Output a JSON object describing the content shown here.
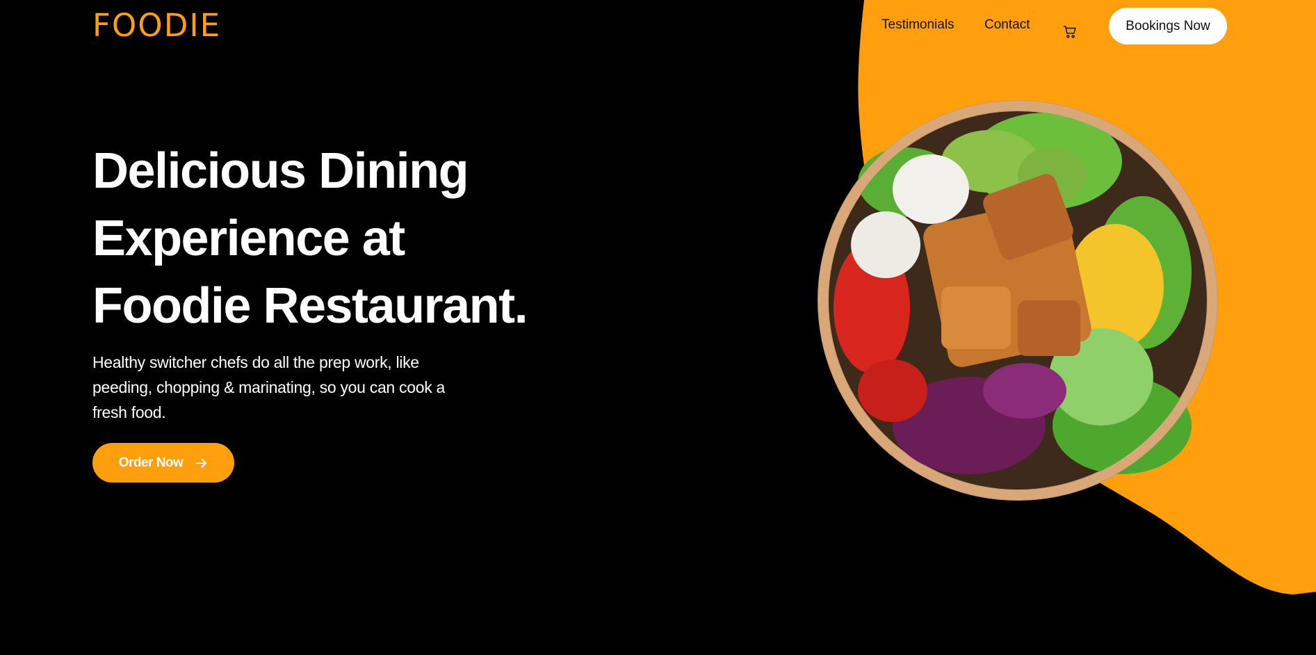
{
  "brand": {
    "logo": "FOODIE"
  },
  "nav": {
    "links": [
      {
        "label": "Testimonials"
      },
      {
        "label": "Contact"
      }
    ],
    "cart_icon": "cart-icon",
    "cta": "Bookings Now"
  },
  "hero": {
    "title_lines": [
      "Delicious Dining",
      "Experience at",
      "Foodie Restaurant."
    ],
    "description": "Healthy switcher chefs do all the prep work, like peeding, chopping & marinating, so you can cook a fresh food.",
    "order_button": "Order Now",
    "order_icon": "arrow-right-icon",
    "image": "salad-bowl"
  },
  "colors": {
    "accent": "#FF9F0D",
    "background": "#000000",
    "button_light": "#FFFFFF"
  }
}
